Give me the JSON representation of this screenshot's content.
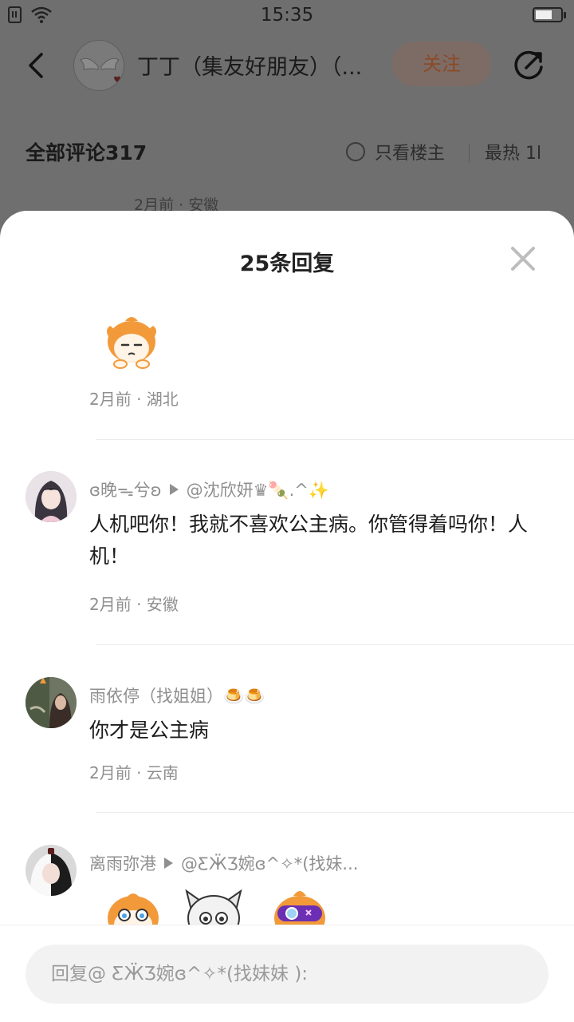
{
  "status_bar": {
    "time": "15:35"
  },
  "header": {
    "author_name": "丁丁（集友好朋友）（...",
    "follow_label": "关注"
  },
  "comments_bar": {
    "title": "全部评论317",
    "only_op_label": "只看楼主",
    "sort_label": "最热 1l"
  },
  "background_comment": {
    "meta": "2月前 · 安徽"
  },
  "sheet": {
    "title": "25条回复",
    "replies": [
      {
        "meta": "2月前 · 湖北"
      },
      {
        "username": "ɞ晚ᯓ兮ʚ",
        "reply_to": "@沈欣妍♛🍡.^✨",
        "text": "人机吧你！我就不喜欢公主病。你管得着吗你！人机！",
        "meta": "2月前 · 安徽"
      },
      {
        "username": "雨依停（找姐姐）🍮🍮",
        "text": "你才是公主病",
        "meta": "2月前 · 云南"
      },
      {
        "username": "离雨弥港",
        "reply_to": "@ƸӜƷ婉ɞ^✧*(找妹...",
        "meta": ""
      }
    ]
  },
  "input": {
    "placeholder": "回复@ ƸӜƷ婉ɞ^✧*(找妹妹 ):"
  },
  "colors": {
    "overlay": "#6f6f6f",
    "accent_orange": "#f29a3a",
    "meta_gray": "#8f8f8f"
  }
}
